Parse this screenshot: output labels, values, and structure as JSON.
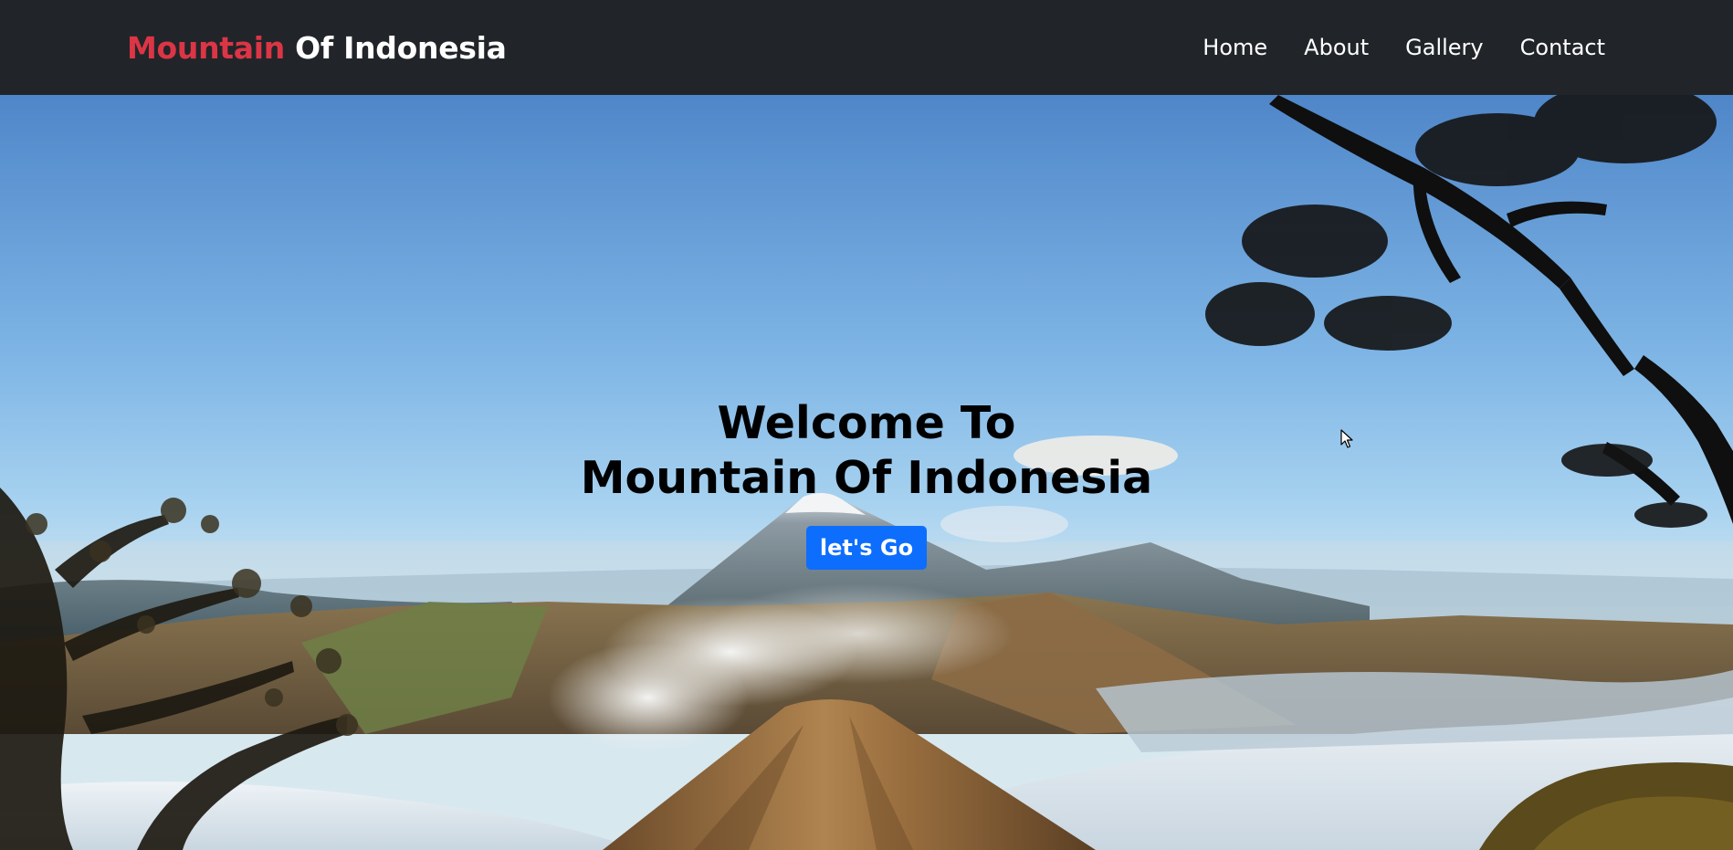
{
  "navbar": {
    "brand_accent": "Mountain",
    "brand_rest": " Of Indonesia",
    "links": [
      {
        "label": "Home"
      },
      {
        "label": "About"
      },
      {
        "label": "Gallery"
      },
      {
        "label": "Contact"
      }
    ]
  },
  "hero": {
    "title_line1": "Welcome To",
    "title_line2": "Mountain Of Indonesia",
    "button_label": "let's Go",
    "background_image": "volcano-landscape"
  },
  "colors": {
    "navbar_bg": "#212529",
    "brand_accent": "#dc3545",
    "button_bg": "#0d6efd",
    "nav_text": "#ffffff"
  }
}
